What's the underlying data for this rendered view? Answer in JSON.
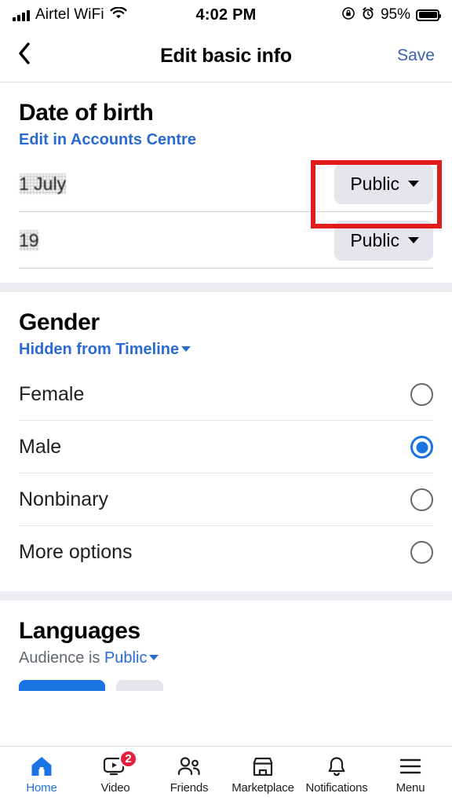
{
  "status_bar": {
    "carrier": "Airtel WiFi",
    "time": "4:02 PM",
    "battery_percent": "95%",
    "icons": [
      "signal-bars-icon",
      "wifi-icon",
      "rotation-lock-icon",
      "alarm-clock-icon",
      "battery-icon"
    ]
  },
  "header": {
    "back_label": "‹",
    "title": "Edit basic info",
    "save_label": "Save"
  },
  "date_of_birth": {
    "title": "Date of birth",
    "edit_link": "Edit in Accounts Centre",
    "rows": [
      {
        "value": "1 July",
        "audience": "Public",
        "highlighted": true
      },
      {
        "value": "19",
        "audience": "Public",
        "highlighted": false
      }
    ]
  },
  "gender": {
    "title": "Gender",
    "audience_label": "Hidden from Timeline",
    "options": [
      {
        "label": "Female",
        "selected": false
      },
      {
        "label": "Male",
        "selected": true
      },
      {
        "label": "Nonbinary",
        "selected": false
      },
      {
        "label": "More options",
        "selected": false
      }
    ]
  },
  "languages": {
    "title": "Languages",
    "audience_prefix": "Audience is ",
    "audience_value": "Public"
  },
  "tabbar": {
    "items": [
      {
        "label": "Home",
        "icon": "home-icon",
        "active": true,
        "badge": ""
      },
      {
        "label": "Video",
        "icon": "video-icon",
        "active": false,
        "badge": "2"
      },
      {
        "label": "Friends",
        "icon": "friends-icon",
        "active": false,
        "badge": ""
      },
      {
        "label": "Marketplace",
        "icon": "marketplace-icon",
        "active": false,
        "badge": ""
      },
      {
        "label": "Notifications",
        "icon": "bell-icon",
        "active": false,
        "badge": ""
      },
      {
        "label": "Menu",
        "icon": "hamburger-menu-icon",
        "active": false,
        "badge": ""
      }
    ]
  },
  "colors": {
    "accent_blue": "#1b74e4",
    "link_blue": "#2a6ad3",
    "save_blue": "#3a62a8",
    "pill_gray": "#e4e6eb",
    "divider": "#ced0d4",
    "section_gap": "#ebedf0",
    "highlight_red": "#e01b1b",
    "badge_red": "#e41e3f"
  }
}
